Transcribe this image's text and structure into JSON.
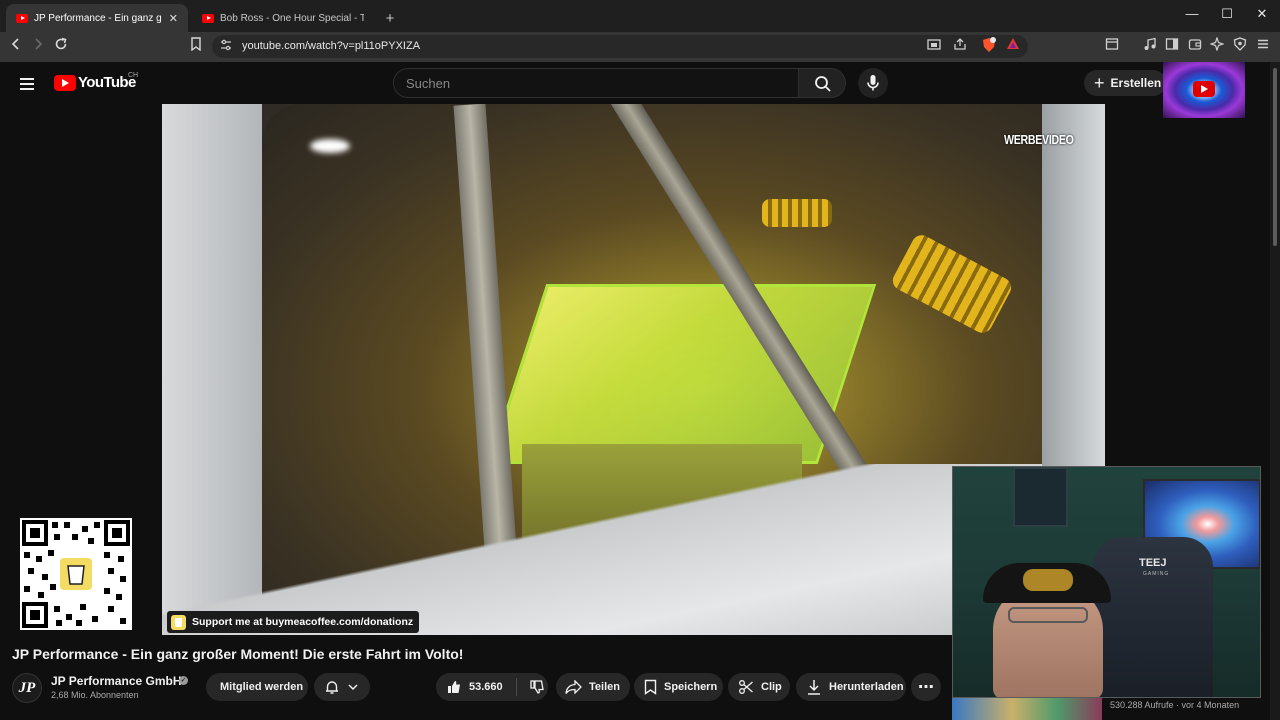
{
  "browser": {
    "tabs": [
      {
        "title": "JP Performance - Ein ganz großer Moment!",
        "active": true,
        "close": "✕"
      },
      {
        "title": "Bob Ross - One Hour Special - The Grand Canyon",
        "active": false
      }
    ],
    "new_tab": "+",
    "window_controls": {
      "minimize": "—",
      "maximize": "☐",
      "close": "✕"
    },
    "url": "youtube.com/watch?v=pl11oPYXIZA",
    "icons": [
      "back-icon",
      "forward-icon",
      "reload-icon",
      "bookmark-icon",
      "site-settings-icon",
      "cast-icon",
      "share-icon",
      "brave-shields-icon",
      "rewards-icon",
      "tab-search-icon",
      "media-icon",
      "sidebar-icon",
      "wallet-icon",
      "leo-icon",
      "vpn-icon",
      "menu-icon"
    ]
  },
  "youtube": {
    "logo_text": "YouTube",
    "country_code": "CH",
    "search_placeholder": "Suchen",
    "create_label": "Erstellen",
    "accent": "#ff0000"
  },
  "video": {
    "ad_label": "WERBEVIDEO",
    "title": "JP Performance - Ein ganz großer Moment! Die erste Fahrt im Volto!",
    "donation": "Support me at buymeacoffee.com/donationz"
  },
  "channel": {
    "initials": "JP",
    "name": "JP Performance GmbH",
    "verified": "✓",
    "subscribers": "2,68 Mio. Abonnenten",
    "join_label": "Mitglied werden"
  },
  "actions": {
    "likes": "53.660",
    "share": "Teilen",
    "save": "Speichern",
    "clip": "Clip",
    "download": "Herunterladen",
    "more": "⋯"
  },
  "stats": {
    "views": "530.288 Aufrufe · vor 4 Monaten"
  },
  "webcam": {
    "chair_text": "TEEJ",
    "chair_subtext": "GAMING"
  }
}
